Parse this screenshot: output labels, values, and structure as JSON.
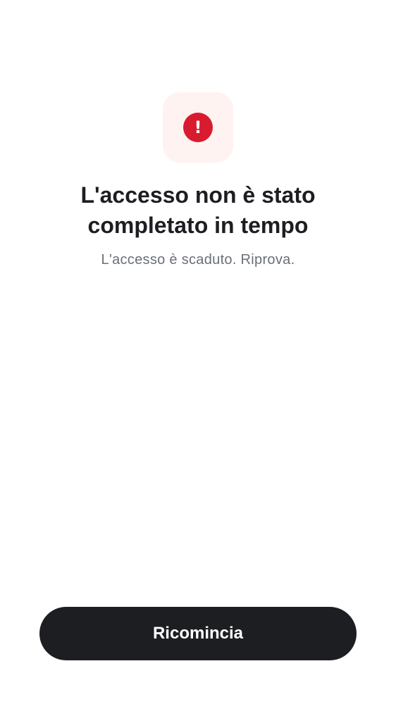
{
  "status": {
    "icon": "alert-circle-icon",
    "icon_glyph": "!",
    "icon_color": "#d81b2e",
    "icon_background": "#fff3f2"
  },
  "message": {
    "title": "L'accesso non è stato completato in tempo",
    "subtitle": "L'accesso è scaduto. Riprova."
  },
  "actions": {
    "restart_label": "Ricomincia",
    "button_color": "#1d1e22"
  }
}
